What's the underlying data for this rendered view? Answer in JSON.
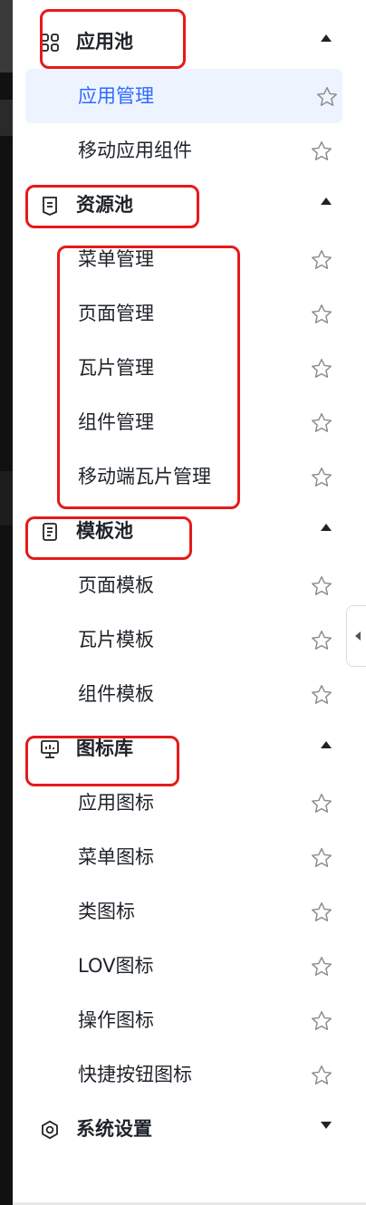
{
  "menu": {
    "groups": [
      {
        "id": "app-pool",
        "title": "应用池",
        "icon": "grid-icon",
        "expanded": true,
        "items": [
          {
            "label": "应用管理",
            "active": true
          },
          {
            "label": "移动应用组件"
          }
        ]
      },
      {
        "id": "resource-pool",
        "title": "资源池",
        "icon": "document-icon",
        "expanded": true,
        "items": [
          {
            "label": "菜单管理"
          },
          {
            "label": "页面管理"
          },
          {
            "label": "瓦片管理"
          },
          {
            "label": "组件管理"
          },
          {
            "label": "移动端瓦片管理"
          }
        ]
      },
      {
        "id": "template-pool",
        "title": "模板池",
        "icon": "copy-icon",
        "expanded": true,
        "items": [
          {
            "label": "页面模板"
          },
          {
            "label": "瓦片模板"
          },
          {
            "label": "组件模板"
          }
        ]
      },
      {
        "id": "icon-library",
        "title": "图标库",
        "icon": "monitor-icon",
        "expanded": true,
        "items": [
          {
            "label": "应用图标"
          },
          {
            "label": "菜单图标"
          },
          {
            "label": "类图标"
          },
          {
            "label": "LOV图标"
          },
          {
            "label": "操作图标"
          },
          {
            "label": "快捷按钮图标"
          }
        ]
      },
      {
        "id": "system-settings",
        "title": "系统设置",
        "icon": "hexagon-settings-icon",
        "expanded": false,
        "items": []
      }
    ]
  },
  "colors": {
    "active_text": "#2f6bff",
    "active_bg": "#eef4ff",
    "highlight": "#e51a1a"
  }
}
